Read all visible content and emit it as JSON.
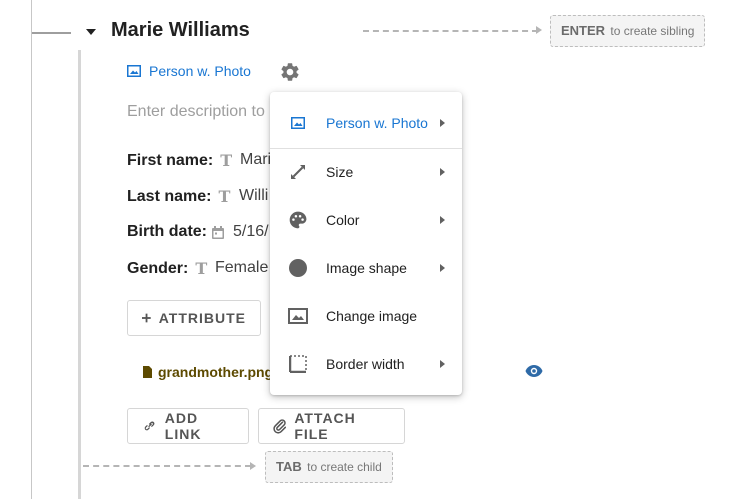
{
  "node": {
    "title": "Marie Williams",
    "type_label": "Person w. Photo",
    "description_placeholder": "Enter description to"
  },
  "hints": {
    "sibling_key": "ENTER",
    "sibling_text": "to create sibling",
    "child_key": "TAB",
    "child_text": "to create child"
  },
  "attributes": [
    {
      "label": "First name:",
      "type_icon": "text-type-icon",
      "value": "Mari"
    },
    {
      "label": "Last name:",
      "type_icon": "text-type-icon",
      "value": "Willi"
    },
    {
      "label": "Birth date:",
      "type_icon": "calendar-icon",
      "value": "5/16/"
    },
    {
      "label": "Gender:",
      "type_icon": "text-type-icon",
      "value": "Female"
    }
  ],
  "type_glyph": "T",
  "buttons": {
    "attribute": "ATTRIBUTE",
    "add_link": "ADD LINK",
    "attach_file": "ATTACH FILE"
  },
  "file": {
    "name": "grandmother.png"
  },
  "menu": {
    "items": [
      {
        "label": "Person w. Photo",
        "icon": "image-icon",
        "submenu": true,
        "active": true
      },
      {
        "label": "Size",
        "icon": "resize-icon",
        "submenu": true
      },
      {
        "label": "Color",
        "icon": "palette-icon",
        "submenu": true
      },
      {
        "label": "Image shape",
        "icon": "circle-icon",
        "submenu": true
      },
      {
        "label": "Change image",
        "icon": "image-icon",
        "submenu": false
      },
      {
        "label": "Border width",
        "icon": "border-icon",
        "submenu": true
      }
    ]
  },
  "colors": {
    "accent": "#1976d2",
    "eye": "#2e6aa7",
    "file": "#5d4a00"
  }
}
